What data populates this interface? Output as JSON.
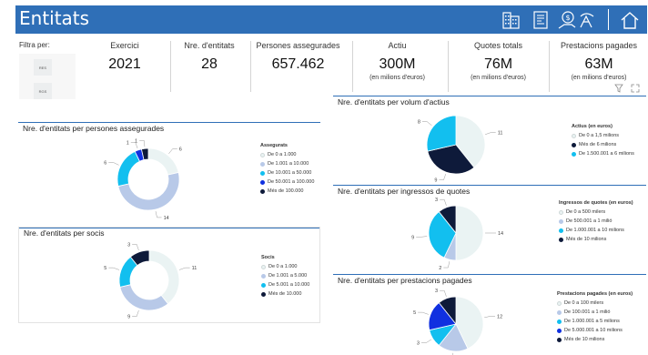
{
  "header": {
    "title": "Entitats"
  },
  "icons": [
    "building-icon",
    "document-icon",
    "hand-money-icon",
    "home-icon"
  ],
  "filter": {
    "label": "Filtra per:",
    "buttons": [
      "RES",
      "RGS"
    ]
  },
  "kpis": [
    {
      "label": "Exercici",
      "value": "2021",
      "sub": ""
    },
    {
      "label": "Nre. d'entitats",
      "value": "28",
      "sub": ""
    },
    {
      "label": "Persones assegurades",
      "value": "657.462",
      "sub": ""
    },
    {
      "label": "Actiu",
      "value": "300M",
      "sub": "(en milions d'euros)"
    },
    {
      "label": "Quotes totals",
      "value": "76M",
      "sub": "(en milions d'euros)"
    },
    {
      "label": "Prestacions pagades",
      "value": "63M",
      "sub": "(en milions d'euros)"
    }
  ],
  "colors": {
    "header": "#2f6fb7",
    "c1": "#eaf3f3",
    "c2": "#b8c9e8",
    "c3": "#12bfef",
    "c4": "#1030e0",
    "c5": "#0e1a3a"
  },
  "chart_data": [
    {
      "type": "pie",
      "donut": true,
      "title": "Nre. d'entitats per persones assegurades",
      "legend_title": "Assegurats",
      "categories": [
        "De 0 a 1.000",
        "De 1.001 a 10.000",
        "De 10.001 a 50.000",
        "De 50.001 a 100.000",
        "Més de 100.000"
      ],
      "values": [
        6,
        14,
        6,
        1,
        1
      ],
      "colors": [
        "#eaf3f3",
        "#b8c9e8",
        "#12bfef",
        "#1030e0",
        "#0e1a3a"
      ]
    },
    {
      "type": "pie",
      "donut": true,
      "title": "Nre. d'entitats per socis",
      "legend_title": "Socis",
      "categories": [
        "De 0 a 1.000",
        "De 1.001 a 5.000",
        "De 5.001 a 10.000",
        "Més de 10.000"
      ],
      "values": [
        11,
        9,
        5,
        3
      ],
      "colors": [
        "#eaf3f3",
        "#b8c9e8",
        "#12bfef",
        "#0e1a3a"
      ]
    },
    {
      "type": "pie",
      "donut": false,
      "title": "Nre. d'entitats per volum d'actius",
      "legend_title": "Actius (en euros)",
      "categories": [
        "De 0 a 1,5 milions",
        "Més de 6 milions",
        "De 1.500.001 a 6 milions"
      ],
      "values": [
        11,
        9,
        8
      ],
      "colors": [
        "#eaf3f3",
        "#0e1a3a",
        "#12bfef"
      ]
    },
    {
      "type": "pie",
      "donut": false,
      "title": "Nre. d'entitats per ingressos de quotes",
      "legend_title": "Ingressos de quotes (en euros)",
      "categories": [
        "De 0 a 500 milers",
        "De 500.001 a 1 milió",
        "De 1.000.001 a 10 milions",
        "Més de 10 milions"
      ],
      "values": [
        14,
        2,
        9,
        3
      ],
      "colors": [
        "#eaf3f3",
        "#b8c9e8",
        "#12bfef",
        "#0e1a3a"
      ]
    },
    {
      "type": "pie",
      "donut": false,
      "title": "Nre. d'entitats per prestacions pagades",
      "legend_title": "Prestacions pagades (en euros)",
      "categories": [
        "De 0 a 100 milers",
        "De 100.001 a 1 milió",
        "De 1.000.001 a 5 milions",
        "De 5.000.001 a 10 milions",
        "Més de 10 milions"
      ],
      "values": [
        12,
        5,
        3,
        5,
        3
      ],
      "colors": [
        "#eaf3f3",
        "#b8c9e8",
        "#12bfef",
        "#1030e0",
        "#0e1a3a"
      ]
    }
  ]
}
